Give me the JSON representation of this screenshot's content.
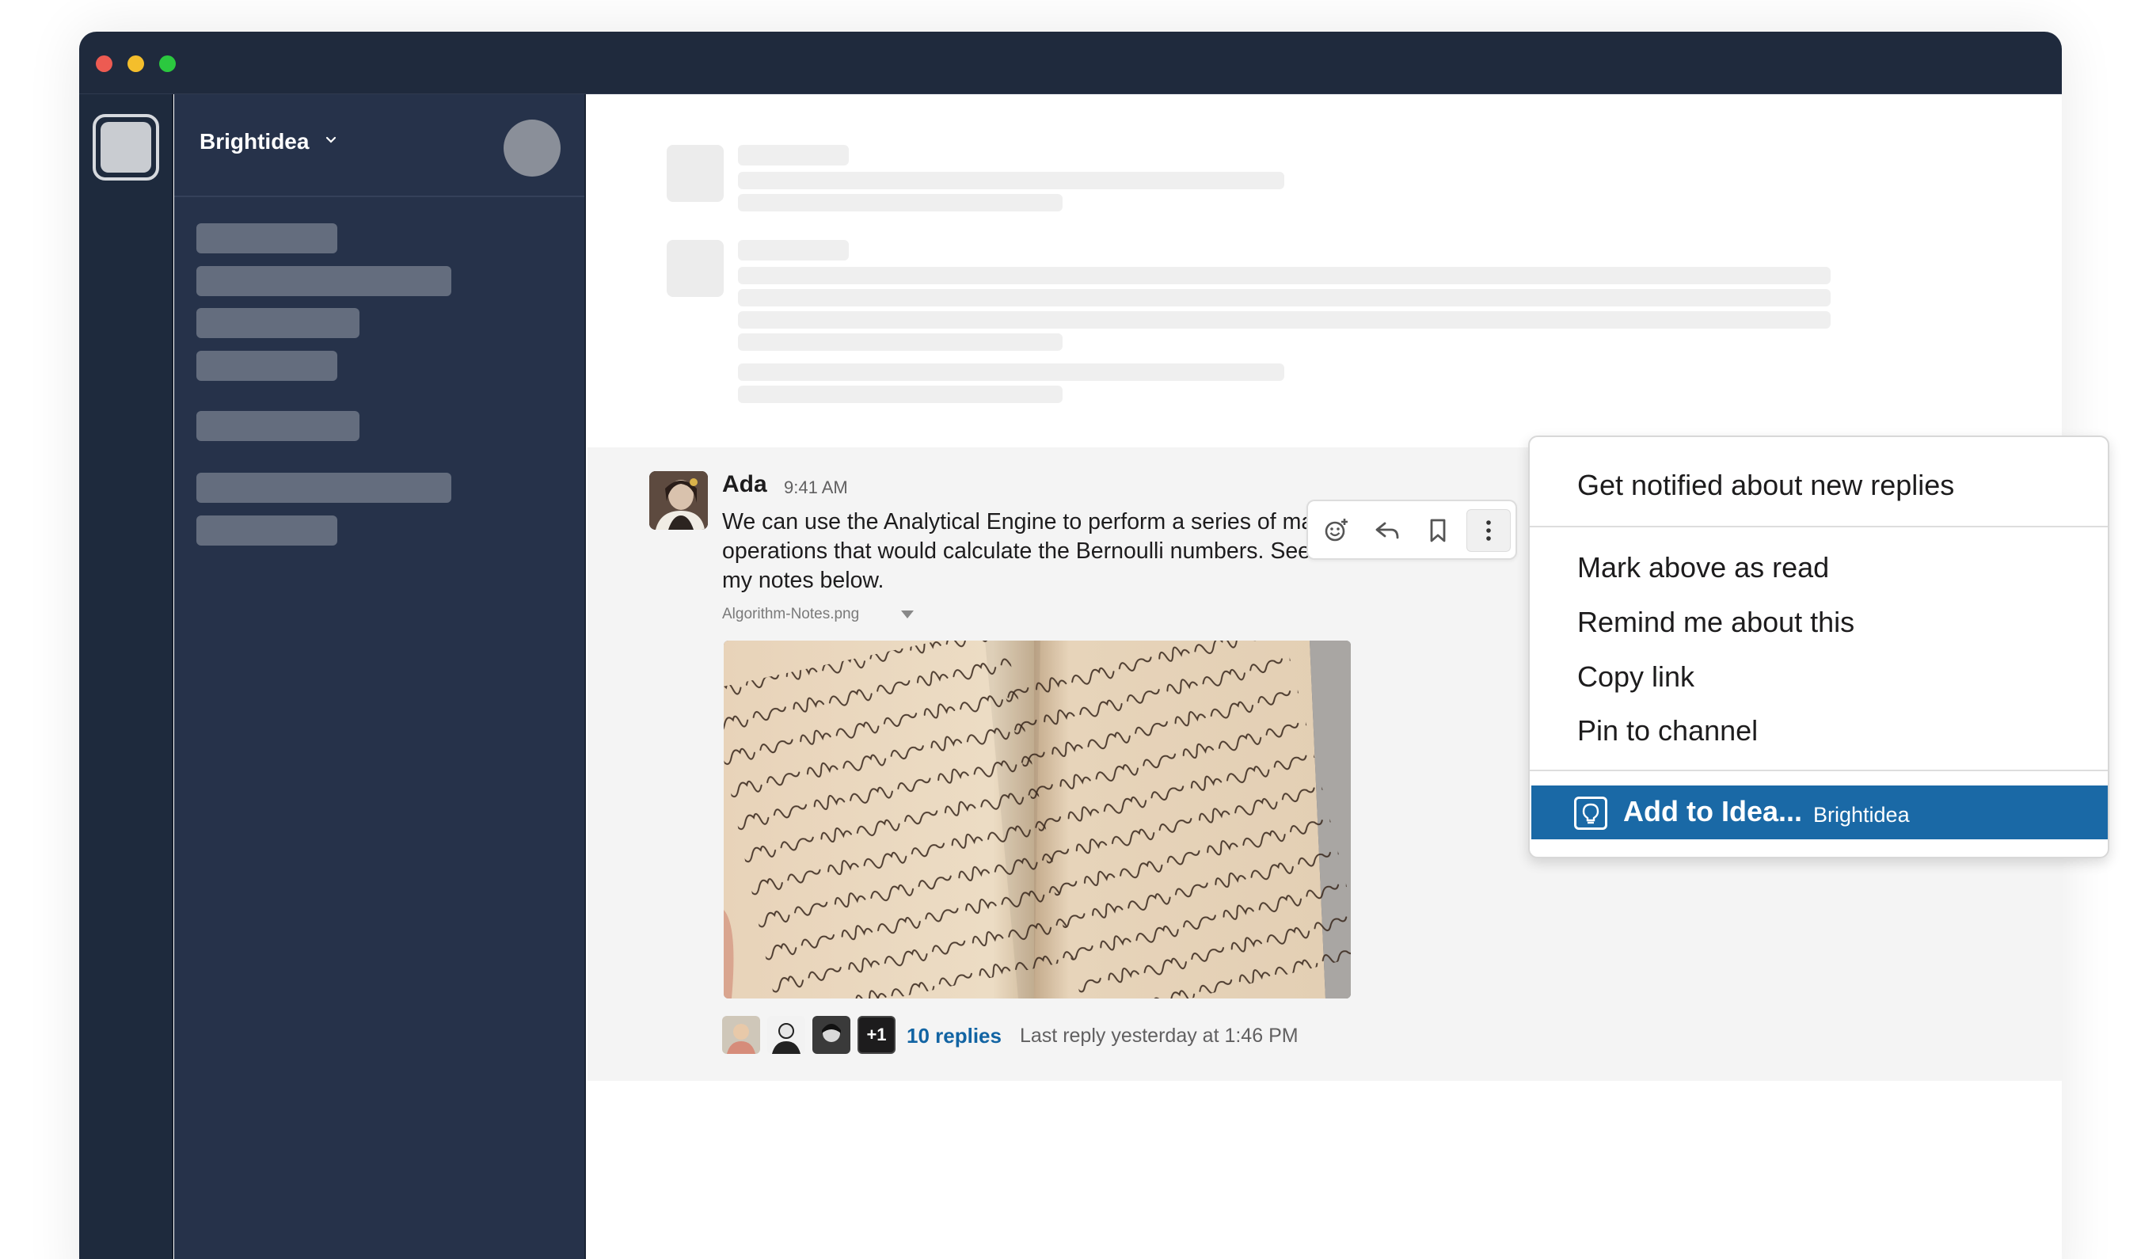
{
  "workspace": {
    "name": "Brightidea"
  },
  "message": {
    "author": "Ada",
    "time": "9:41 AM",
    "text": "We can use the Analytical Engine to perform a series of mathematical operations that would calculate the Bernoulli numbers. See more details in my notes below.",
    "attachment": {
      "file_name": "Algorithm-Notes.png"
    },
    "thread": {
      "extra_count": "+1",
      "replies_label": "10 replies",
      "last_reply": "Last reply yesterday at 1:46 PM"
    }
  },
  "message_actions": {
    "icons": [
      "add-reaction-icon",
      "reply-icon",
      "bookmark-icon",
      "more-actions-icon"
    ]
  },
  "context_menu": {
    "items": [
      "Get notified about new replies",
      "Mark above as read",
      "Remind me about this",
      "Copy link",
      "Pin to channel"
    ],
    "highlighted": {
      "label": "Add to Idea...",
      "app": "Brightidea",
      "icon": "lightbulb-icon"
    }
  },
  "colors": {
    "titlebar": "#1f2a3d",
    "sidebar": "#26324a",
    "highlight": "#1a69a6",
    "link": "#1264a3"
  }
}
